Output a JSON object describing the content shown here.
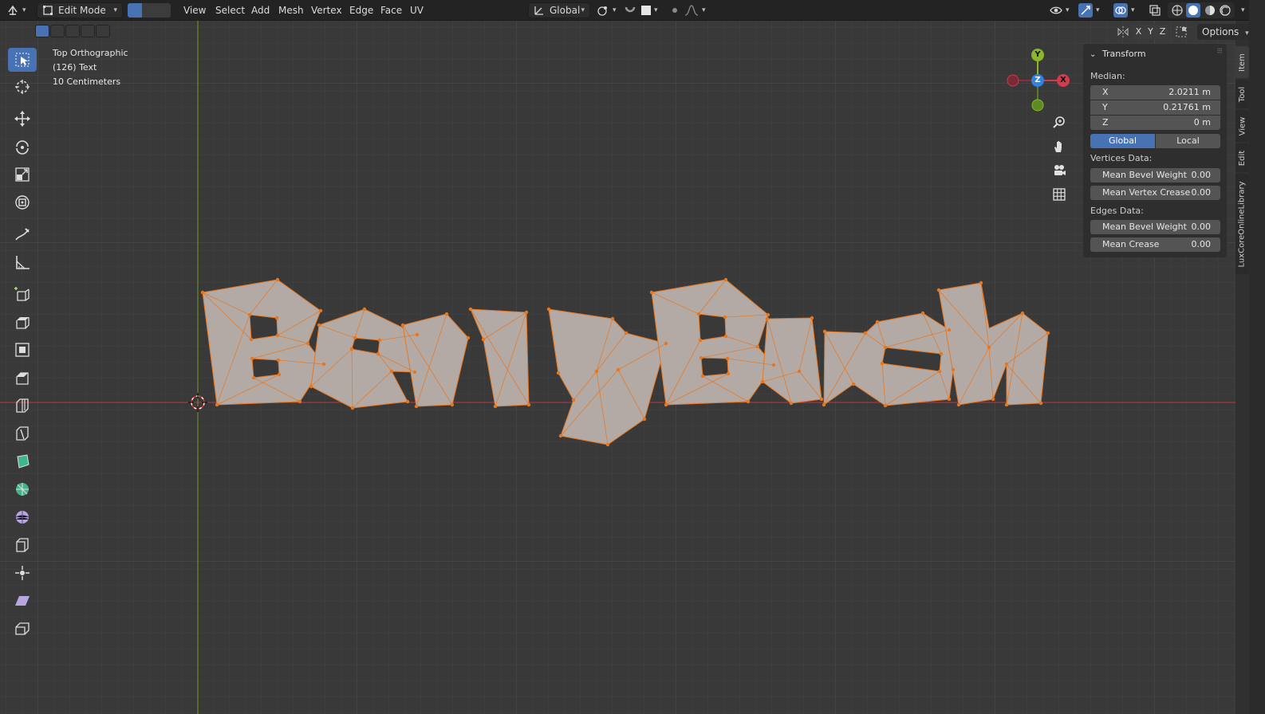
{
  "header": {
    "mode": "Edit Mode",
    "menus": [
      "View",
      "Select",
      "Add",
      "Mesh",
      "Vertex",
      "Edge",
      "Face",
      "UV"
    ],
    "orientation": "Global",
    "options_label": "Options",
    "axis_x": "X",
    "axis_y": "Y",
    "axis_z": "Z"
  },
  "overlay": {
    "view_name": "Top Orthographic",
    "object_info": "(126) Text",
    "scale": "10 Centimeters"
  },
  "gizmo": {
    "x": "X",
    "y": "Y",
    "z": "Z"
  },
  "npanel": {
    "title": "Transform",
    "median_label": "Median:",
    "fields": [
      {
        "key": "X",
        "value": "2.0211 m"
      },
      {
        "key": "Y",
        "value": "0.21761 m"
      },
      {
        "key": "Z",
        "value": "0 m"
      }
    ],
    "space_global": "Global",
    "space_local": "Local",
    "vertices_label": "Vertices Data:",
    "vertices_fields": [
      {
        "key": "Mean Bevel Weight",
        "value": "0.00"
      },
      {
        "key": "Mean Vertex Crease",
        "value": "0.00"
      }
    ],
    "edges_label": "Edges Data:",
    "edges_fields": [
      {
        "key": "Mean Bevel Weight",
        "value": "0.00"
      },
      {
        "key": "Mean Crease",
        "value": "0.00"
      }
    ]
  },
  "tabs": [
    "Item",
    "Tool",
    "View",
    "Edit",
    "LuxCoreOnlineLibrary"
  ],
  "colors": {
    "accent": "#4772b3",
    "mesh_fill": "#b3aaa6",
    "mesh_edge": "#e8761d",
    "axis_x": "#d03b4e",
    "axis_y": "#8bb72b",
    "axis_z": "#2f83e3"
  }
}
